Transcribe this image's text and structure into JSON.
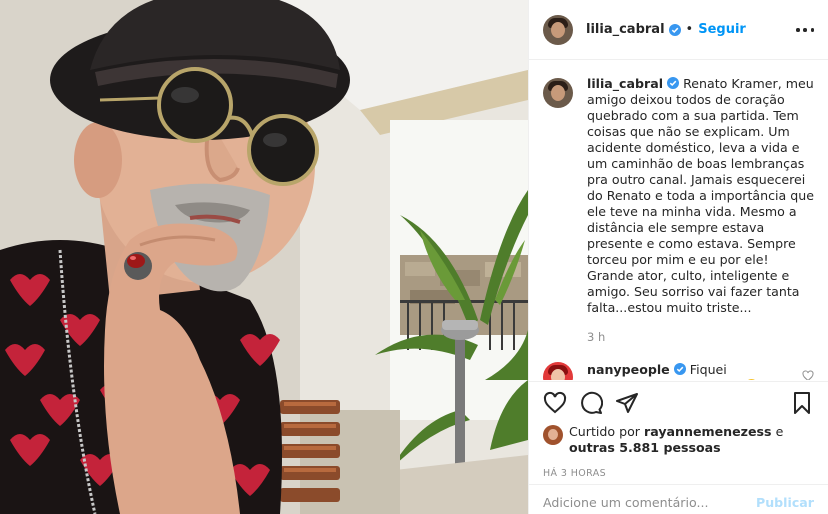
{
  "post": {
    "photo_alt": "Renato Kramer",
    "header": {
      "username": "lilia_cabral",
      "separator": "•",
      "follow_label": "Seguir"
    },
    "caption": {
      "username": "lilia_cabral",
      "text": "Renato Kramer, meu amigo deixou todos de coração quebrado com a sua partida. Tem coisas que não se explicam. Um acidente doméstico, leva a vida e um caminhão de boas lembranças pra outro canal. Jamais esquecerei do Renato e toda a importância que ele teve na minha vida. Mesmo a distância ele sempre estava presente e como estava. Sempre torceu por mim e eu por ele! Grande ator, culto, inteligente e amigo. Seu sorriso vai fazer tanta falta...estou muito triste...",
      "time": "3 h"
    },
    "reply": {
      "username": "nanypeople",
      "text": "Fiquei estarrecida...fatalidade..."
    },
    "likes": {
      "prefix": "Curtido por",
      "user": "rayannemenezess",
      "middle": "e",
      "others": "outras 5.881 pessoas"
    },
    "time_ago": "HÁ 3 HORAS",
    "comment_input": {
      "placeholder": "Adicione um comentário..."
    },
    "publish_label": "Publicar"
  },
  "icons": {
    "verified": "verified-badge-icon",
    "like": "heart-icon",
    "comment": "comment-bubble-icon",
    "share": "paper-plane-icon",
    "save": "bookmark-icon",
    "more": "ellipsis-icon"
  },
  "colors": {
    "accent": "#0095f6",
    "publish_disabled": "#b2dffc",
    "muted": "#8e8e8e",
    "text": "#262626"
  }
}
